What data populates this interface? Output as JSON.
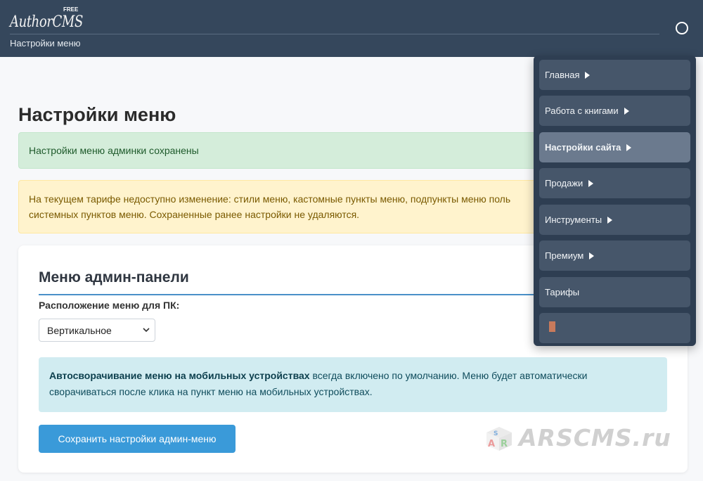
{
  "header": {
    "logo_text": "AuthorCMS",
    "logo_badge": "FREE",
    "subtitle": "Настройки меню"
  },
  "page": {
    "title": "Настройки меню"
  },
  "alerts": {
    "success": "Настройки меню админки сохранены",
    "warning_line1": "На текущем тарифе недоступно изменение: стили меню, кастомные пункты меню, подпункты меню поль",
    "warning_line2": "системных пунктов меню. Сохраненные ранее настройки не удаляются."
  },
  "card": {
    "title": "Меню админ-панели",
    "position_label": "Расположение меню для ПК:",
    "position_selected": "Вертикальное",
    "info_bold": "Автосворачивание меню на мобильных устройствах",
    "info_rest": " всегда включено по умолчанию. Меню будет автоматически сворачиваться после клика на пункт меню на мобильных устройствах.",
    "save_label": "Сохранить настройки админ-меню"
  },
  "watermark": {
    "text": "ARSCMS.ru"
  },
  "menu": {
    "items": [
      {
        "label": "Главная",
        "has_arrow": true,
        "active": false
      },
      {
        "label": "Работа с книгами",
        "has_arrow": true,
        "active": false
      },
      {
        "label": "Настройки сайта",
        "has_arrow": true,
        "active": true
      },
      {
        "label": "Продажи",
        "has_arrow": true,
        "active": false
      },
      {
        "label": "Инструменты",
        "has_arrow": true,
        "active": false
      },
      {
        "label": "Премиум",
        "has_arrow": true,
        "active": false
      },
      {
        "label": "Тарифы",
        "has_arrow": false,
        "active": false
      },
      {
        "label": "",
        "has_arrow": false,
        "active": false,
        "icon": "flag-icon"
      }
    ]
  },
  "colors": {
    "header_bg": "#35475c",
    "menu_bg": "#2e3e52",
    "menu_item_bg": "#46566a",
    "menu_item_active_bg": "#6b7a8e",
    "primary_button": "#3a9ad9",
    "success_bg": "#d4edda",
    "warning_bg": "#fff3cd",
    "info_bg": "#d1ecf1"
  }
}
